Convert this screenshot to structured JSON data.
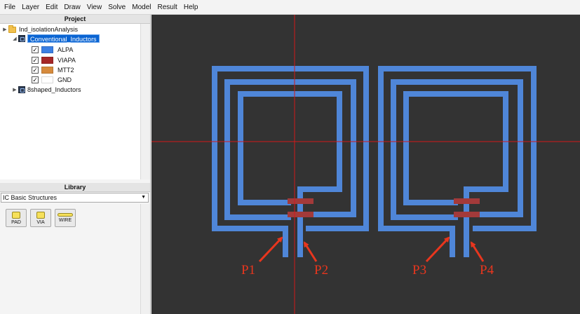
{
  "menu": [
    "File",
    "Layer",
    "Edit",
    "Draw",
    "View",
    "Solve",
    "Model",
    "Result",
    "Help"
  ],
  "project_panel": {
    "title": "Project",
    "root": "Ind_isolationAnalysis",
    "expanded_node": "Conventional_Inductors",
    "layers": [
      {
        "name": "ALPA",
        "checked": "✓",
        "color": "#3b7fe3"
      },
      {
        "name": "VIAPA",
        "checked": "✓",
        "color": "#a52727"
      },
      {
        "name": "MTT2",
        "checked": "✓",
        "color": "#d68b3d"
      },
      {
        "name": "GND",
        "checked": "✓",
        "color": "#ffffff"
      }
    ],
    "collapsed_node": "8shaped_Inductors"
  },
  "library_panel": {
    "title": "Library",
    "dropdown_value": "IC Basic Structures",
    "buttons": [
      "PAD",
      "VIA",
      "WIRE"
    ]
  },
  "canvas": {
    "background": "#333333",
    "trace_color": "#4f86d8",
    "via_color": "#a33a3a",
    "crosshair_color": "#d11a1a",
    "arrow_color": "#e8361e",
    "ports": [
      "P1",
      "P2",
      "P3",
      "P4"
    ]
  }
}
